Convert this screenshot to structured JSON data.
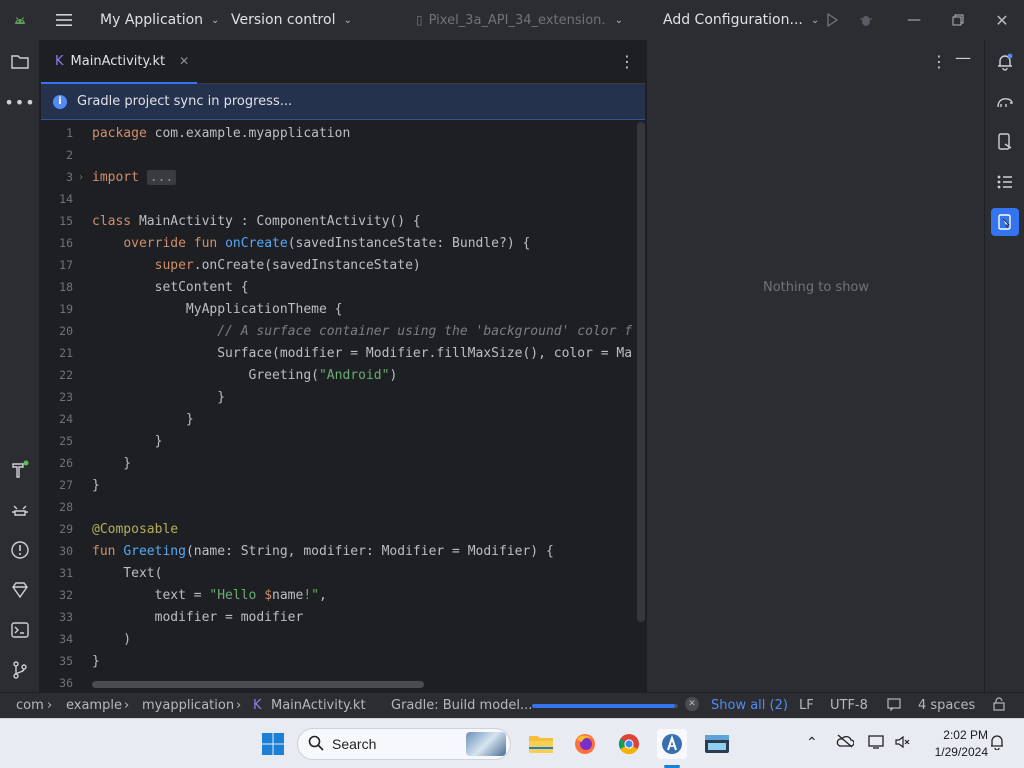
{
  "title_bar": {
    "project": "My Application",
    "vcs": "Version control",
    "device": "Pixel_3a_API_34_extension...",
    "run_config": "Add Configuration..."
  },
  "editor": {
    "tab_label": "MainActivity.kt",
    "banner": "Gradle project sync in progress...",
    "lines": [
      {
        "n": "1",
        "html": "<span class='kw'>package</span> com.example.myapplication"
      },
      {
        "n": "2",
        "html": ""
      },
      {
        "n": "3",
        "html": "<span class='kw'>import</span> <span class='collapsed'>...</span>",
        "fold": "›"
      },
      {
        "n": "14",
        "html": ""
      },
      {
        "n": "15",
        "html": "<span class='kw'>class</span> MainActivity : ComponentActivity() {"
      },
      {
        "n": "16",
        "html": "    <span class='kw'>override fun</span> <span class='fnc'>onCreate</span>(savedInstanceState: Bundle?) {"
      },
      {
        "n": "17",
        "html": "        <span class='kw'>super</span>.onCreate(savedInstanceState)"
      },
      {
        "n": "18",
        "html": "        setContent {"
      },
      {
        "n": "19",
        "html": "            MyApplicationTheme {"
      },
      {
        "n": "20",
        "html": "                <span class='cmt'>// A surface container using the 'background' color f</span>"
      },
      {
        "n": "21",
        "html": "                Surface(modifier = Modifier.fillMaxSize(), color = Ma"
      },
      {
        "n": "22",
        "html": "                    Greeting(<span class='str'>\"Android\"</span>)"
      },
      {
        "n": "23",
        "html": "                }"
      },
      {
        "n": "24",
        "html": "            }"
      },
      {
        "n": "25",
        "html": "        }"
      },
      {
        "n": "26",
        "html": "    }"
      },
      {
        "n": "27",
        "html": "}"
      },
      {
        "n": "28",
        "html": ""
      },
      {
        "n": "29",
        "html": "<span class='ann'>@Composable</span>"
      },
      {
        "n": "30",
        "html": "<span class='kw'>fun</span> <span class='fnc'>Greeting</span>(name: String, modifier: Modifier = Modifier) {"
      },
      {
        "n": "31",
        "html": "    Text("
      },
      {
        "n": "32",
        "html": "        text = <span class='str'>\"Hello </span><span class='tmpl'>$</span>name<span class='str'>!\"</span>,"
      },
      {
        "n": "33",
        "html": "        modifier = modifier"
      },
      {
        "n": "34",
        "html": "    )"
      },
      {
        "n": "35",
        "html": "}"
      },
      {
        "n": "36",
        "html": ""
      }
    ]
  },
  "side_panel": {
    "empty_text": "Nothing to show"
  },
  "status_bar": {
    "breadcrumb": [
      "com",
      "example",
      "myapplication",
      "MainActivity.kt"
    ],
    "task": "Gradle: Build model...",
    "progress": 0.98,
    "show_all": "Show all (2)",
    "line_sep": "LF",
    "encoding": "UTF-8",
    "indent": "4 spaces"
  },
  "taskbar": {
    "search": "Search",
    "time": "2:02 PM",
    "date": "1/29/2024"
  },
  "colors": {
    "accent": "#3574f0",
    "keyword": "#cf8e6d",
    "string": "#6aab73",
    "comment": "#7a7e85"
  }
}
